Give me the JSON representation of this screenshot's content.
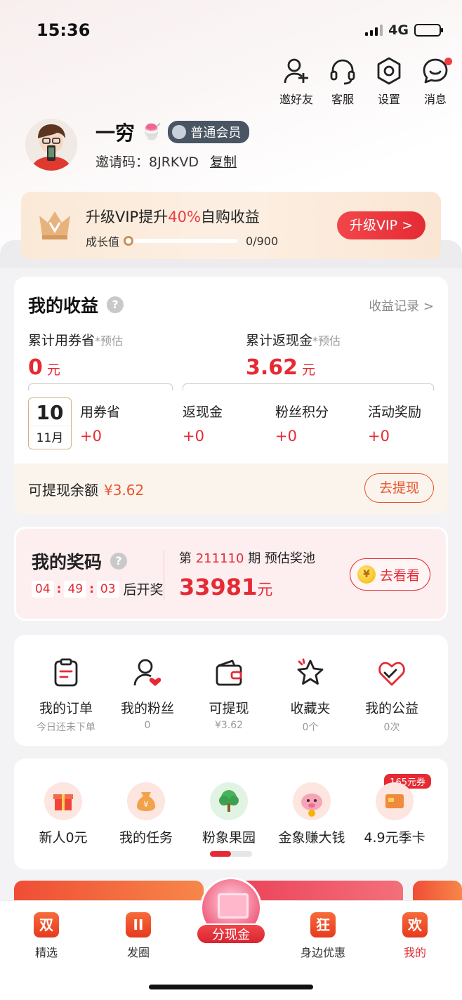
{
  "status": {
    "time": "15:36",
    "network": "4G"
  },
  "top_actions": [
    {
      "label": "邀好友",
      "icon": "add-friend-icon"
    },
    {
      "label": "客服",
      "icon": "headset-icon"
    },
    {
      "label": "设置",
      "icon": "settings-icon"
    },
    {
      "label": "消息",
      "icon": "message-icon"
    }
  ],
  "profile": {
    "name": "一穷",
    "badge": "普通会员",
    "invite_label": "邀请码：",
    "invite_code": "8JRKVD",
    "copy_label": "复制"
  },
  "vip": {
    "title_prefix": "升级VIP提升",
    "title_pct": "40%",
    "title_suffix": "自购收益",
    "growth_label": "成长值",
    "growth_progress": "0/900",
    "growth_fraction": 0,
    "button": "升级VIP >"
  },
  "earnings": {
    "title": "我的收益",
    "record_link": "收益记录 >",
    "saved_label": "累计用券省",
    "saved_est": "*预估",
    "saved_value": "0",
    "saved_unit": "元",
    "cashback_label": "累计返现金",
    "cashback_est": "*预估",
    "cashback_value": "3.62",
    "cashback_unit": "元",
    "date_day": "10",
    "date_month": "11月",
    "stats": [
      {
        "label": "用券省",
        "value": "+0"
      },
      {
        "label": "返现金",
        "value": "+0"
      },
      {
        "label": "粉丝积分",
        "value": "+0"
      },
      {
        "label": "活动奖励",
        "value": "+0"
      }
    ],
    "withdraw_label": "可提现余额",
    "withdraw_amount": "¥3.62",
    "withdraw_button": "去提现"
  },
  "prize": {
    "title": "我的奖码",
    "timer": {
      "h": "04",
      "m": "49",
      "s": "03"
    },
    "timer_suffix": "后开奖",
    "period_prefix": "第",
    "period": "211110",
    "period_suffix": "期 预估奖池",
    "pool_value": "33981",
    "pool_unit": "元",
    "button": "去看看",
    "coin_glyph": "¥"
  },
  "quick": [
    {
      "label": "我的订单",
      "sub": "今日还未下单",
      "icon": "clipboard-icon"
    },
    {
      "label": "我的粉丝",
      "sub": "0",
      "icon": "fans-icon"
    },
    {
      "label": "可提现",
      "sub": "¥3.62",
      "icon": "wallet-icon"
    },
    {
      "label": "收藏夹",
      "sub": "0个",
      "icon": "star-icon"
    },
    {
      "label": "我的公益",
      "sub": "0次",
      "icon": "charity-icon"
    }
  ],
  "tools": [
    {
      "label": "新人0元",
      "icon": "gift-icon"
    },
    {
      "label": "我的任务",
      "icon": "money-bag-icon"
    },
    {
      "label": "粉象果园",
      "icon": "tree-icon"
    },
    {
      "label": "金象赚大钱",
      "icon": "piggy-icon"
    },
    {
      "label": "4.9元季卡",
      "icon": "card-icon"
    }
  ],
  "coupon_badge": "165元券",
  "tabs": [
    {
      "label": "精选",
      "glyph": "双"
    },
    {
      "label": "发圈",
      "glyph": "II"
    },
    {
      "label": "分现金",
      "glyph": ""
    },
    {
      "label": "身边优惠",
      "glyph": "狂"
    },
    {
      "label": "我的",
      "glyph": "欢"
    }
  ],
  "colors": {
    "accent": "#e52a34",
    "orange": "#e8542c",
    "vip_bg": "#fbe9d7"
  }
}
